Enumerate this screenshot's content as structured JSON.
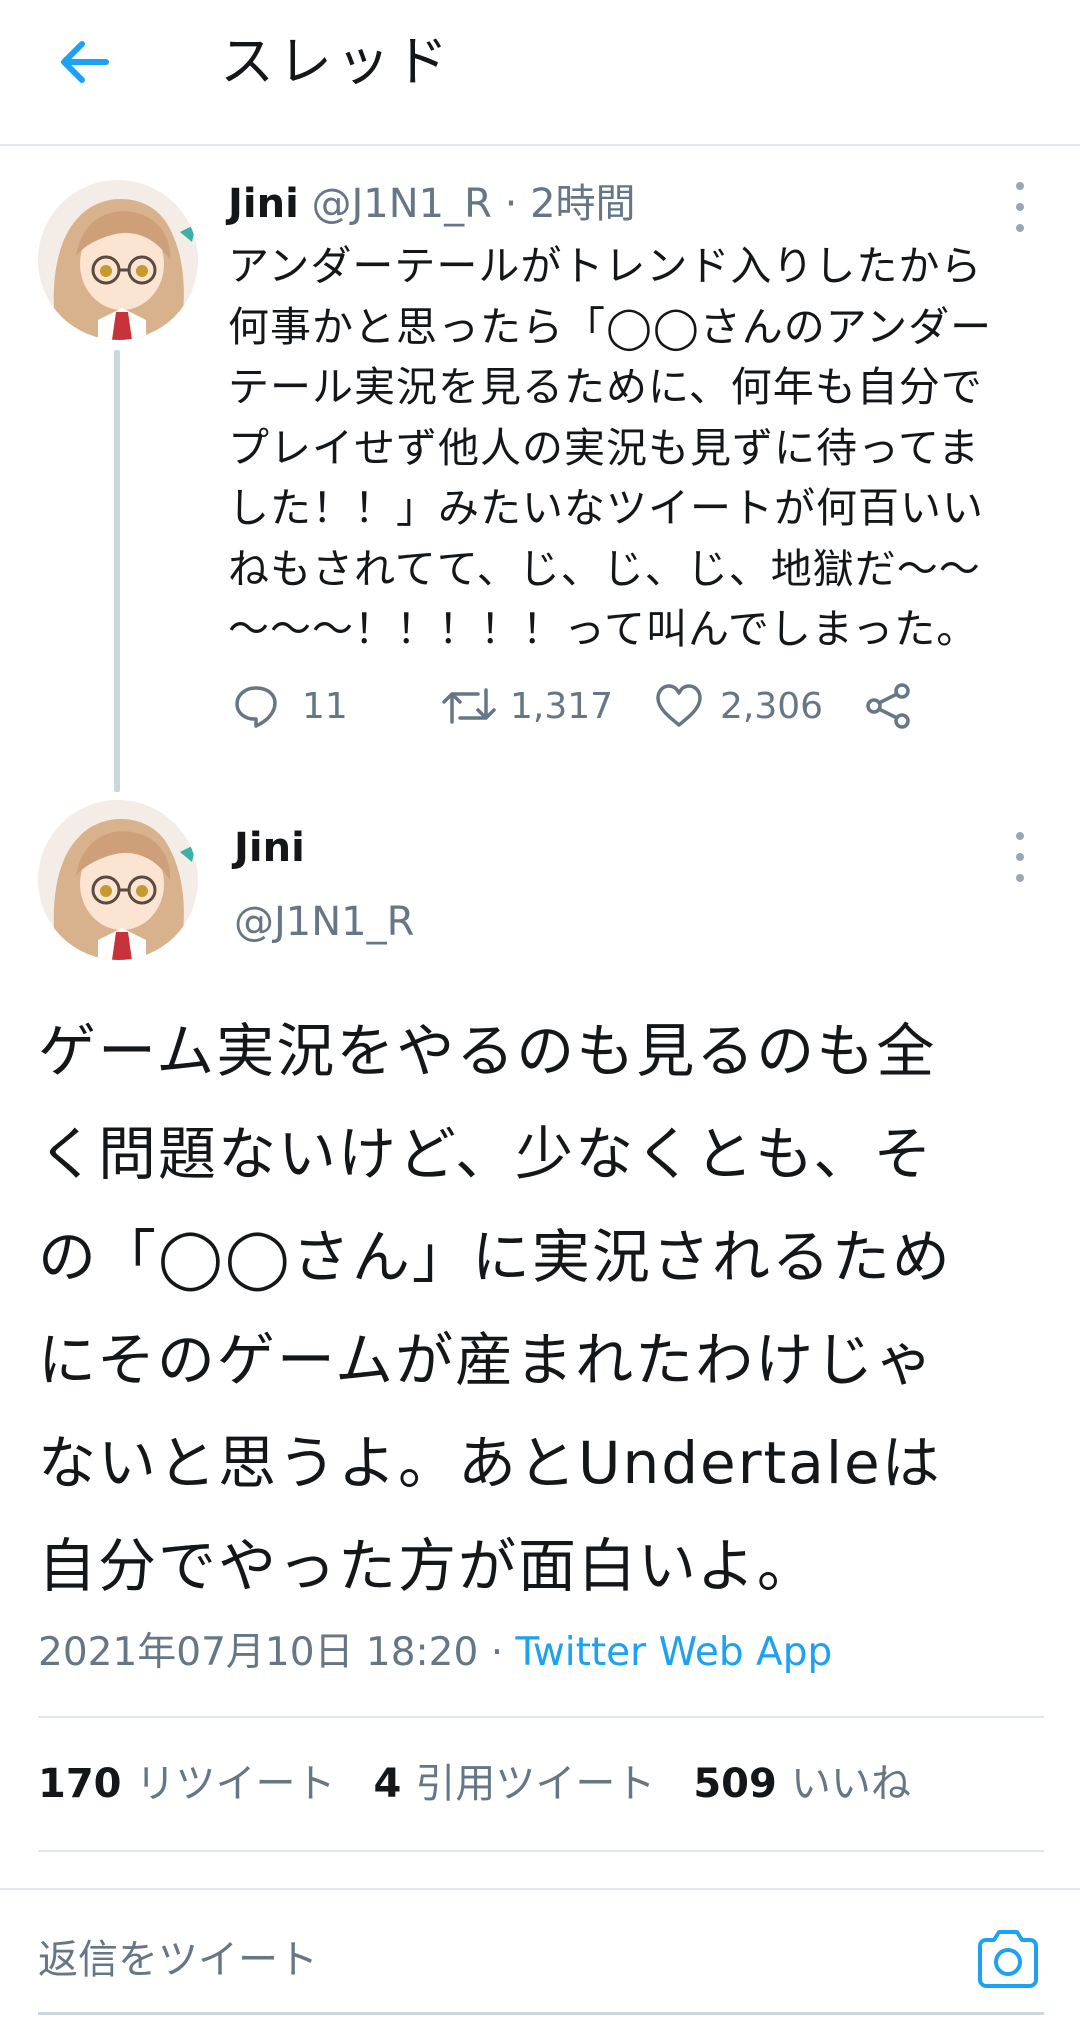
{
  "header": {
    "title": "スレッド"
  },
  "tweet1": {
    "name": "Jini",
    "handle": "@J1N1_R",
    "sep": " · ",
    "time": "2時間",
    "text": "アンダーテールがトレンド入りしたから\n何事かと思ったら「◯◯さんのアンダー\nテール実況を見るために、何年も自分で\nプレイせず他人の実況も見ずに待ってま\nした！！」みたいなツイートが何百いい\nねもされてて、じ、じ、じ、地獄だ〜〜\n〜〜〜！！！！！って叫んでしまった。",
    "replies": "11",
    "retweets": "1,317",
    "likes": "2,306"
  },
  "tweet2": {
    "name": "Jini",
    "handle": "@J1N1_R",
    "text": "ゲーム実況をやるのも見るのも全\nく問題ないけど、少なくとも、そ\nの「◯◯さん」に実況されるため\nにそのゲームが産まれたわけじゃ\nないと思うよ。あとUndertaleは\n自分でやった方が面白いよ。",
    "datetime": "2021年07月10日 18:20",
    "sep": " · ",
    "source": "Twitter Web App",
    "retweet_count": "170",
    "retweet_label": "リツイート",
    "quote_count": "4",
    "quote_label": "引用ツイート",
    "like_count": "509",
    "like_label": "いいね"
  },
  "reply": {
    "placeholder": "返信をツイート"
  },
  "icons": [
    "back-arrow-icon",
    "more-icon",
    "reply-icon",
    "retweet-icon",
    "like-icon",
    "share-icon",
    "camera-icon"
  ],
  "colors": {
    "accent": "#1da1f2",
    "text": "#14171a",
    "muted": "#657786",
    "border": "#e1e8ed"
  }
}
